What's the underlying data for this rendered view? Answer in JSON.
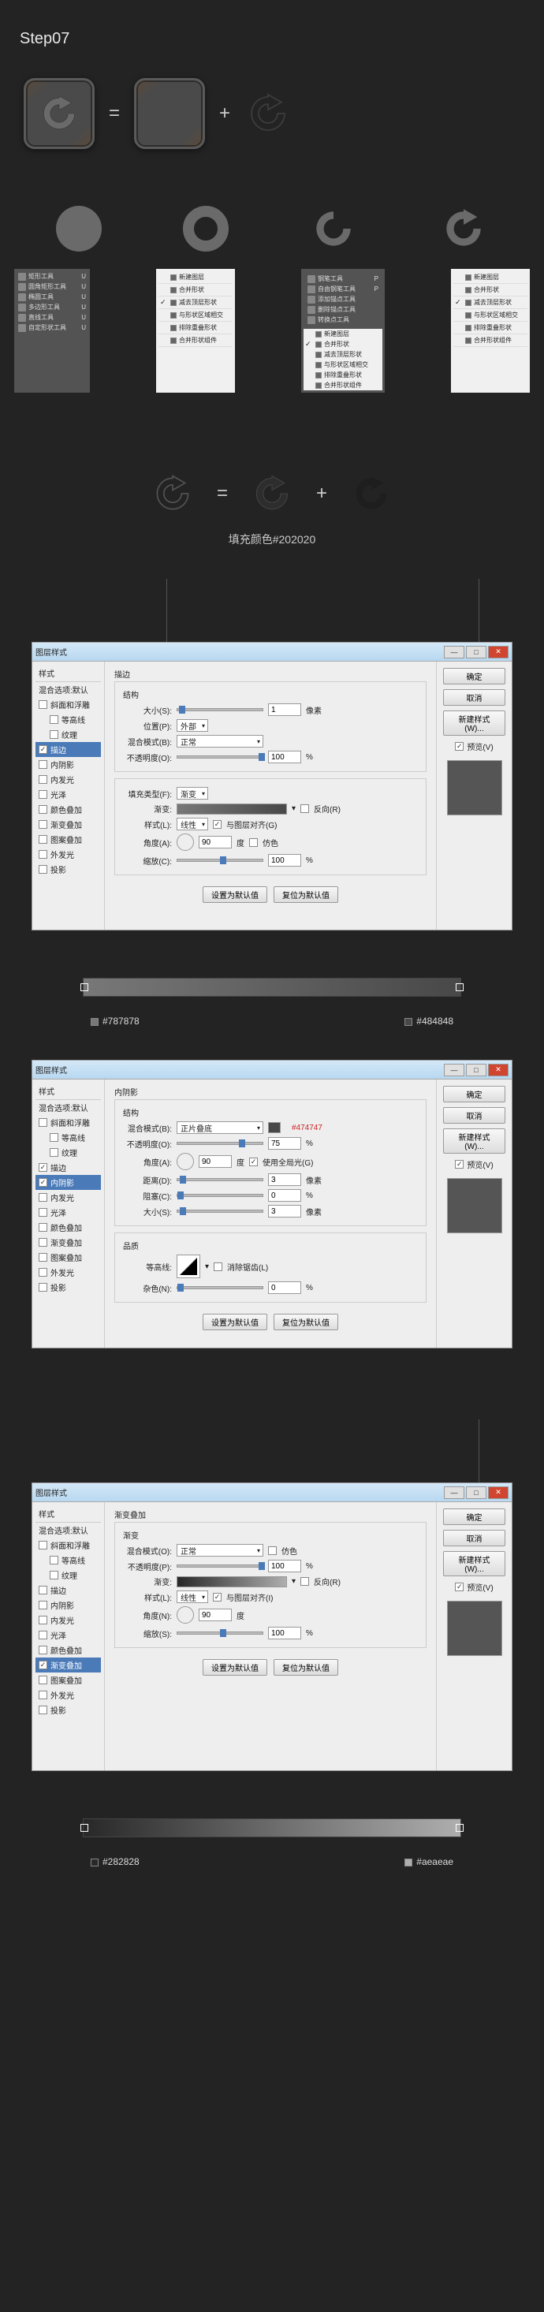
{
  "step_title": "Step07",
  "equation": {
    "equals": "=",
    "plus": "+"
  },
  "tool_panels": {
    "shapes": {
      "items": [
        "矩形工具",
        "圆角矩形工具",
        "椭圆工具",
        "多边形工具",
        "直线工具",
        "自定形状工具"
      ],
      "key": "U"
    },
    "path_ops_1": {
      "items": [
        "新建图层",
        "合并形状",
        "减去顶层形状",
        "与形状区域相交",
        "排除重叠形状",
        "合并形状组件"
      ]
    },
    "pen_tools": {
      "items": [
        "钢笔工具",
        "自由钢笔工具",
        "添加锚点工具",
        "删除锚点工具",
        "转换点工具"
      ],
      "key": "P"
    },
    "path_ops_2": {
      "items": [
        "新建图层",
        "合并形状",
        "减去顶层形状",
        "与形状区域相交",
        "排除重叠形状",
        "合并形状组件"
      ]
    },
    "path_ops_3": {
      "items": [
        "新建图层",
        "合并形状",
        "减去顶层形状",
        "与形状区域相交",
        "排除重叠形状",
        "合并形状组件"
      ]
    }
  },
  "fill_color": "填充颜色#202020",
  "dialog": {
    "title": "图层样式",
    "sidebar_title": "样式",
    "sidebar": {
      "blend": "混合选项:默认",
      "bevel": "斜面和浮雕",
      "contour": "等高线",
      "texture": "纹理",
      "stroke": "描边",
      "inner_shadow": "内阴影",
      "inner_glow": "内发光",
      "satin": "光泽",
      "color_overlay": "颜色叠加",
      "gradient_overlay": "渐变叠加",
      "pattern_overlay": "图案叠加",
      "outer_glow": "外发光",
      "drop_shadow": "投影"
    },
    "buttons": {
      "ok": "确定",
      "cancel": "取消",
      "new_style": "新建样式(W)...",
      "preview": "预览(V)",
      "make_default": "设置为默认值",
      "reset_default": "复位为默认值"
    }
  },
  "stroke_panel": {
    "title": "描边",
    "group_structure": "结构",
    "size_label": "大小(S):",
    "size_val": "1",
    "size_unit": "像素",
    "position_label": "位置(P):",
    "position_val": "外部",
    "blend_mode_label": "混合模式(B):",
    "blend_mode_val": "正常",
    "opacity_label": "不透明度(O):",
    "opacity_val": "100",
    "opacity_unit": "%",
    "fill_type_label": "填充类型(F):",
    "fill_type_val": "渐变",
    "gradient_label": "渐变:",
    "reverse": "反向(R)",
    "style_label": "样式(L):",
    "style_val": "线性",
    "align_layer": "与图层对齐(G)",
    "angle_label": "角度(A):",
    "angle_val": "90",
    "dither": "仿色",
    "scale_label": "缩放(C):",
    "scale_val": "100",
    "scale_unit": "%"
  },
  "stroke_colors": {
    "left": "#787878",
    "right": "#484848"
  },
  "inner_shadow_panel": {
    "title": "内阴影",
    "group": "结构",
    "blend_mode_label": "混合模式(B):",
    "blend_mode_val": "正片叠底",
    "color_note": "#474747",
    "opacity_label": "不透明度(O):",
    "opacity_val": "75",
    "opacity_unit": "%",
    "angle_label": "角度(A):",
    "angle_val": "90",
    "global_light": "使用全局光(G)",
    "distance_label": "距离(D):",
    "distance_val": "3",
    "distance_unit": "像素",
    "choke_label": "阻塞(C):",
    "choke_val": "0",
    "choke_unit": "%",
    "size_label": "大小(S):",
    "size_val": "3",
    "size_unit": "像素",
    "quality_group": "品质",
    "contour_label": "等高线:",
    "anti_alias": "消除锯齿(L)",
    "noise_label": "杂色(N):",
    "noise_val": "0",
    "noise_unit": "%"
  },
  "gradient_overlay_panel": {
    "title": "渐变叠加",
    "group": "渐变",
    "blend_mode_label": "混合模式(O):",
    "blend_mode_val": "正常",
    "dither": "仿色",
    "opacity_label": "不透明度(P):",
    "opacity_val": "100",
    "opacity_unit": "%",
    "gradient_label": "渐变:",
    "reverse": "反向(R)",
    "style_label": "样式(L):",
    "style_val": "线性",
    "align_layer": "与图层对齐(I)",
    "angle_label": "角度(N):",
    "angle_val": "90",
    "scale_label": "缩放(S):",
    "scale_val": "100",
    "scale_unit": "%"
  },
  "gradient_colors": {
    "left": "#282828",
    "right": "#aeaeae"
  }
}
